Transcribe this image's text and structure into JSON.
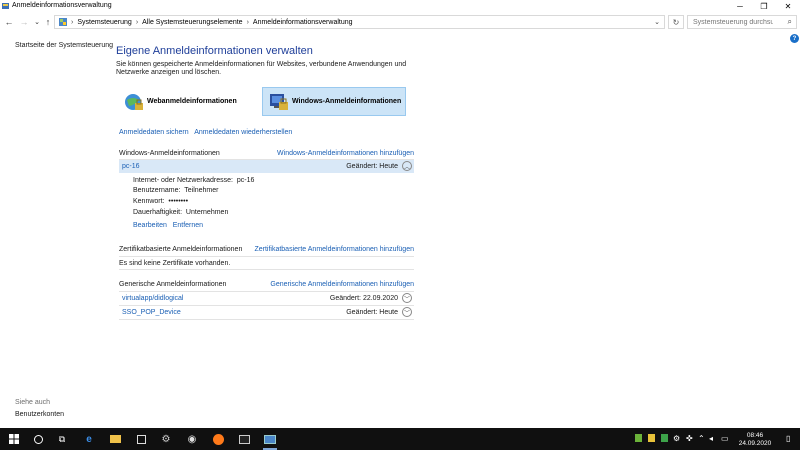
{
  "window": {
    "title": "Anmeldeinformationsverwaltung"
  },
  "address": {
    "crumbs": [
      "Systemsteuerung",
      "Alle Systemsteuerungselemente",
      "Anmeldeinformationsverwaltung"
    ],
    "search_placeholder": "Systemsteuerung durchsuchen"
  },
  "sidebar": {
    "home_link": "Startseite der Systemsteuerung",
    "see_also_label": "Siehe auch",
    "user_accounts_link": "Benutzerkonten"
  },
  "main": {
    "heading": "Eigene Anmeldeinformationen verwalten",
    "description": "Sie können gespeicherte Anmeldeinformationen für Websites, verbundene Anwendungen und Netzwerke anzeigen und löschen.",
    "types": [
      {
        "label": "Webanmeldeinformationen",
        "icon": "web-credentials-icon",
        "selected": false
      },
      {
        "label": "Windows-Anmeldeinformationen",
        "icon": "windows-credentials-icon",
        "selected": true
      }
    ],
    "backup_label": "Anmeldedaten sichern",
    "restore_label": "Anmeldedaten wiederherstellen",
    "windows_section": {
      "title": "Windows-Anmeldeinformationen",
      "add_label": "Windows-Anmeldeinformationen hinzufügen",
      "entry": {
        "name": "pc-16",
        "modified": "Geändert:  Heute",
        "address_label": "Internet- oder Netzwerkadresse:",
        "address_value": "pc-16",
        "user_label": "Benutzername:",
        "user_value": "Teilnehmer",
        "password_label": "Kennwort:",
        "password_value": "••••••••",
        "persistence_label": "Dauerhaftigkeit:",
        "persistence_value": "Unternehmen",
        "edit_label": "Bearbeiten",
        "remove_label": "Entfernen"
      }
    },
    "cert_section": {
      "title": "Zertifikatbasierte Anmeldeinformationen",
      "add_label": "Zertifikatbasierte Anmeldeinformationen hinzufügen",
      "empty_text": "Es sind keine Zertifikate vorhanden."
    },
    "generic_section": {
      "title": "Generische Anmeldeinformationen",
      "add_label": "Generische Anmeldeinformationen hinzufügen",
      "entries": [
        {
          "name": "virtualapp/didlogical",
          "modified": "Geändert:  22.09.2020"
        },
        {
          "name": "SSO_POP_Device",
          "modified": "Geändert:  Heute"
        }
      ]
    }
  },
  "taskbar": {
    "time": "08:46",
    "date": "24.09.2020"
  },
  "colors": {
    "accent": "#1a5fb4",
    "heading": "#1e3e99",
    "selection": "#cce4f7",
    "taskbar": "#101010"
  }
}
